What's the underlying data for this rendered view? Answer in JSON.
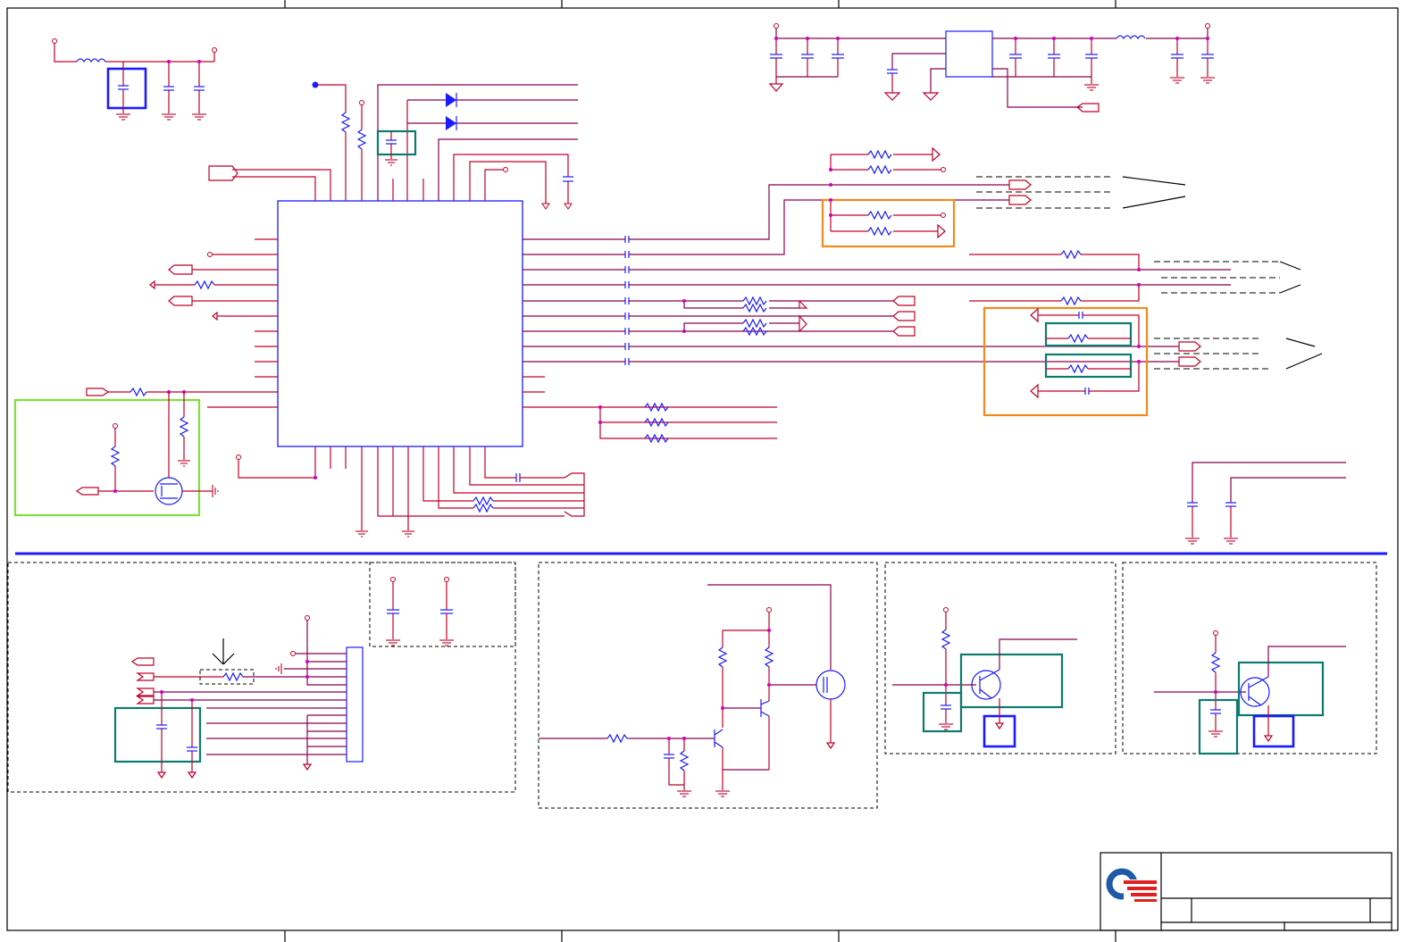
{
  "page": {
    "background": "#ffffff"
  },
  "colors": {
    "wire": "#c0002a",
    "net": "#8a0050",
    "part": "#1a1aff",
    "junction": "#d000c0",
    "highlight_orange": "#f08a1e",
    "highlight_teal": "#0e7a6e",
    "highlight_green": "#7ee03a",
    "logo_blue": "#1e5aa8",
    "logo_red": "#e02020"
  },
  "icons": {
    "logo": "company-logo",
    "ground": "ground-symbol",
    "mosfet": "mosfet-symbol",
    "transistor": "npn-transistor-symbol",
    "diode": "diode-symbol"
  },
  "title_block": {
    "title": "",
    "size": "",
    "document_number": "",
    "revision": "",
    "date": "",
    "sheet": ""
  }
}
